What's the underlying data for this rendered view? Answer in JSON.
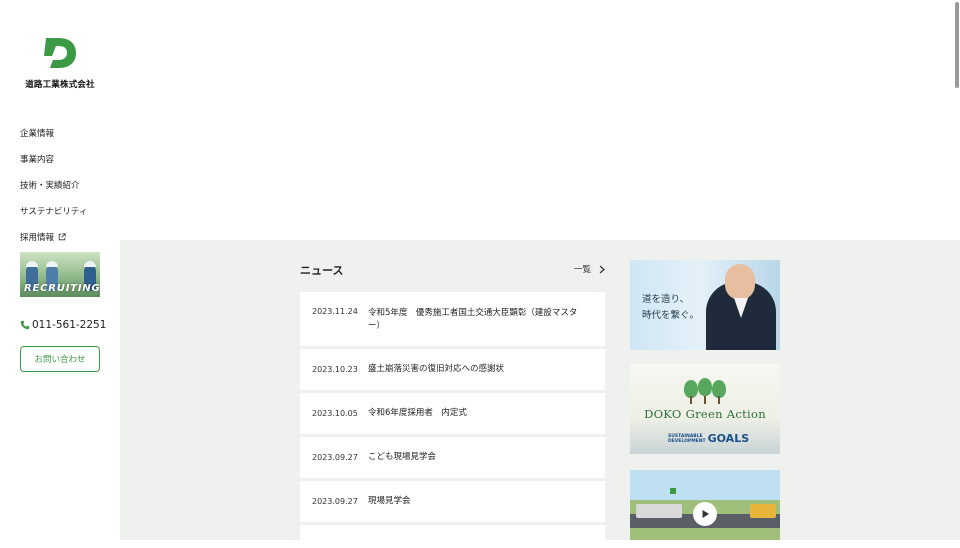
{
  "brand": {
    "name": "道路工業株式会社",
    "accent": "#3d9a44"
  },
  "nav": {
    "items": [
      {
        "label": "企業情報"
      },
      {
        "label": "事業内容"
      },
      {
        "label": "技術・実績紹介"
      },
      {
        "label": "サステナビリティ"
      },
      {
        "label": "採用情報",
        "icon": "external-link-icon"
      }
    ]
  },
  "recruit_banner": {
    "label": "RECRUITING"
  },
  "phone": {
    "icon": "phone-icon",
    "number": "011-561-2251"
  },
  "contact_button": {
    "label": "お問い合わせ"
  },
  "news": {
    "title": "ニュース",
    "all_label": "一覧",
    "items": [
      {
        "date": "2023.11.24",
        "text": "令和5年度　優秀施工者国土交通大臣顕彰（建設マスター）"
      },
      {
        "date": "2023.10.23",
        "text": "盛土崩落災害の復旧対応への感謝状"
      },
      {
        "date": "2023.10.05",
        "text": "令和6年度採用者　内定式"
      },
      {
        "date": "2023.09.27",
        "text": "こども現場見学会"
      },
      {
        "date": "2023.09.27",
        "text": "現場見学会"
      }
    ]
  },
  "banners": {
    "message": {
      "line1": "道を造り、",
      "line2": "時代を繋ぐ。"
    },
    "green": {
      "title": "DOKO Green Action",
      "sdg_small_1": "SUSTAINABLE",
      "sdg_small_2": "DEVELOPMENT",
      "sdg_big": "GOALS"
    },
    "video": {
      "icon": "play-icon"
    }
  }
}
